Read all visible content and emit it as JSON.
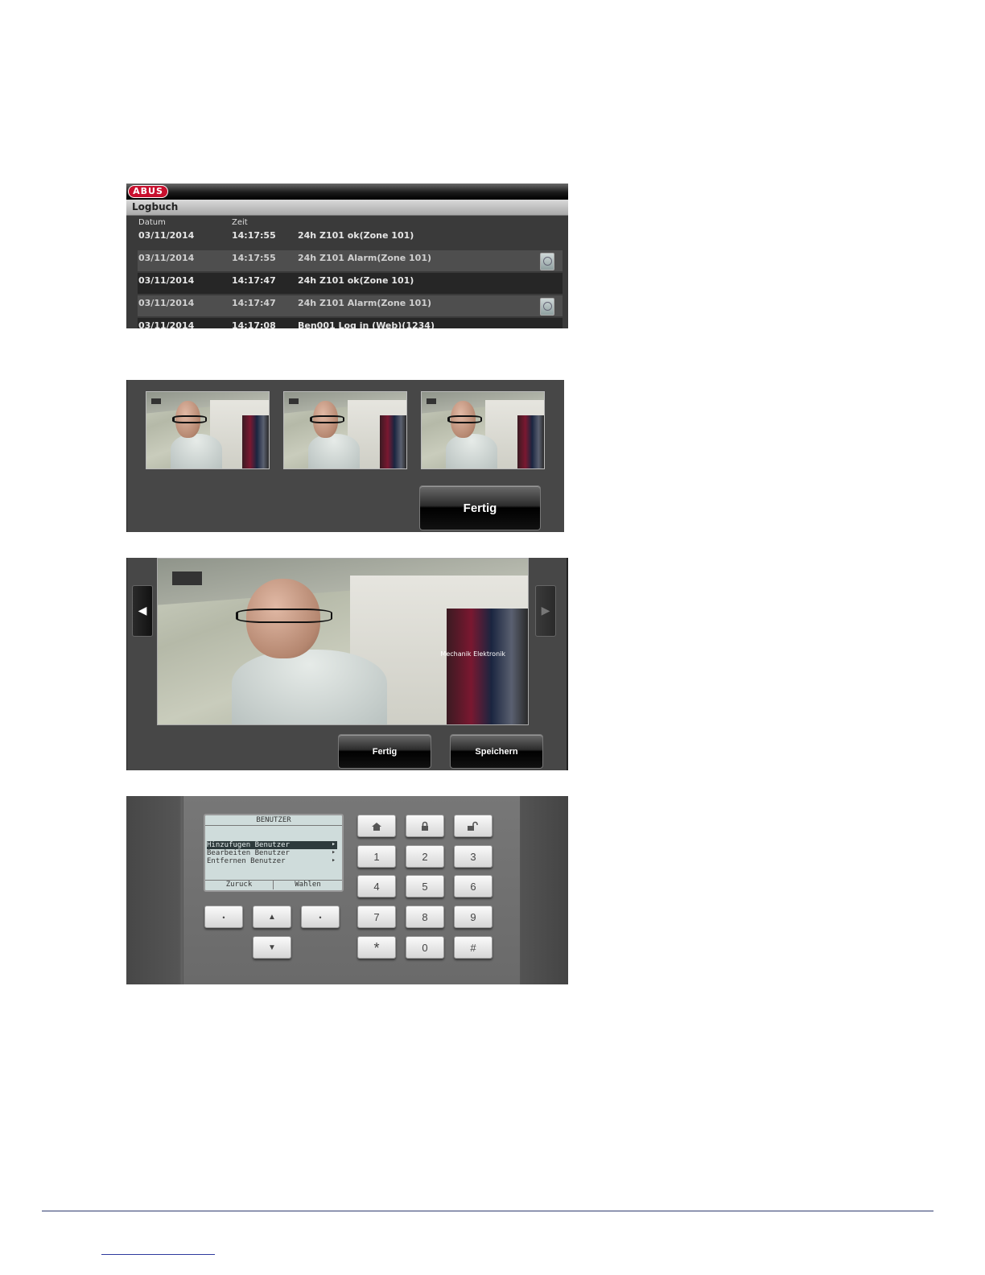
{
  "logbuch": {
    "brand": "ABUS",
    "title": "Logbuch",
    "headers": {
      "date": "Datum",
      "time": "Zeit"
    },
    "rows": [
      {
        "date": "03/11/2014",
        "time": "14:17:55",
        "event": "24h Z101 ok(Zone 101)",
        "has_camera": false
      },
      {
        "date": "03/11/2014",
        "time": "14:17:55",
        "event": "24h Z101 Alarm(Zone 101)",
        "has_camera": true
      },
      {
        "date": "03/11/2014",
        "time": "14:17:47",
        "event": "24h Z101 ok(Zone 101)",
        "has_camera": false
      },
      {
        "date": "03/11/2014",
        "time": "14:17:47",
        "event": "24h Z101 Alarm(Zone 101)",
        "has_camera": true
      },
      {
        "date": "03/11/2014",
        "time": "14:17:08",
        "event": "Ben001 Log in (Web)(1234)",
        "has_camera": false
      }
    ]
  },
  "thumbnails": {
    "count": 3,
    "done_label": "Fertig"
  },
  "viewer": {
    "done_label": "Fertig",
    "save_label": "Speichern",
    "prev_icon": "arrow-left-icon",
    "next_icon": "arrow-right-icon",
    "sign_text": "Mechanik Elektronik"
  },
  "keypad": {
    "lcd": {
      "title": "BENUTZER",
      "items": [
        "Hinzufugen Benutzer",
        "Bearbeiten Benutzer",
        "Entfernen Benutzer"
      ],
      "selected_index": 0,
      "soft_left": "Zuruck",
      "soft_right": "Wahlen"
    },
    "nav_keys": {
      "left": "•",
      "up": "▲",
      "right": "•",
      "down": "▼"
    },
    "top_keys": [
      "home-icon",
      "lock-icon",
      "unlock-icon"
    ],
    "digits": [
      "1",
      "2",
      "3",
      "4",
      "5",
      "6",
      "7",
      "8",
      "9",
      "*",
      "0",
      "#"
    ]
  },
  "colors": {
    "brand_red": "#c8102e",
    "panel_dark": "#474747",
    "footer_line": "#2e3a6e"
  }
}
